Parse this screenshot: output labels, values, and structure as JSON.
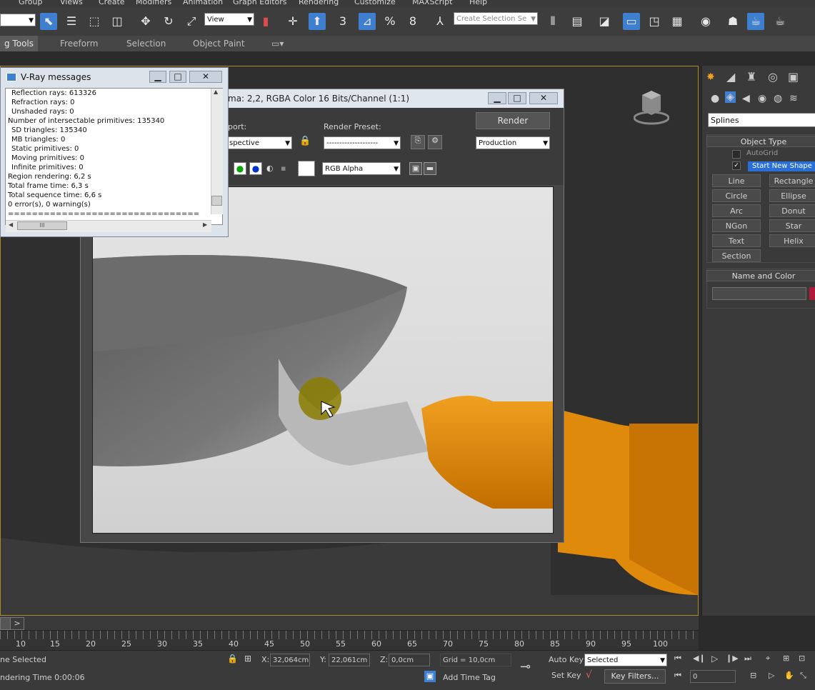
{
  "menu": [
    "Group",
    "Views",
    "Create",
    "Modifiers",
    "Animation",
    "Graph Editors",
    "Rendering",
    "Customize",
    "MAXScript",
    "Help"
  ],
  "toolbar": {
    "view_dropdown": "View",
    "selection_set_placeholder": "Create Selection Se",
    "snaps": {
      "snap3": "3",
      "percent": "%",
      "spinner": "8"
    }
  },
  "ribbon": {
    "tabs": [
      "g Tools",
      "Freeform",
      "Selection",
      "Object Paint"
    ]
  },
  "vray_messages": {
    "title": "V-Ray messages",
    "lines": [
      "Reflection rays: 613326",
      "Refraction rays: 0",
      "Unshaded rays: 0",
      "Number of intersectable primitives: 135340",
      "SD triangles: 135340",
      "MB triangles: 0",
      "Static primitives: 0",
      "Moving primitives: 0",
      "Infinite primitives: 0",
      "Region rendering: 6,2 s",
      "Total frame time: 6,3 s",
      "Total sequence time: 6,6 s",
      "0 error(s), 0 warning(s)",
      "================================"
    ],
    "scroll_label": "III"
  },
  "frame_buffer": {
    "title": "ma: 2,2, RGBA Color 16 Bits/Channel (1:1)",
    "viewport_label": "port:",
    "viewport_value": "spective",
    "render_preset_label": "Render Preset:",
    "render_preset_value": "--------------------",
    "render_button": "Render",
    "production_value": "Production",
    "channel_value": "RGB Alpha"
  },
  "command_panel": {
    "category": "Splines",
    "object_type_header": "Object Type",
    "autogrid": "AutoGrid",
    "start_new_shape": "Start New Shape",
    "buttons": [
      "Line",
      "Rectangle",
      "Circle",
      "Ellipse",
      "Arc",
      "Donut",
      "NGon",
      "Star",
      "Text",
      "Helix",
      "Section"
    ],
    "name_color_header": "Name and Color"
  },
  "timeline": {
    "ticks": [
      "10",
      "15",
      "20",
      "25",
      "30",
      "35",
      "40",
      "45",
      "50",
      "55",
      "60",
      "65",
      "70",
      "75",
      "80",
      "85",
      "90",
      "95",
      "100"
    ],
    "slider_label": ">"
  },
  "status": {
    "selection": "ne Selected",
    "rendering_time": "ndering Time  0:00:06",
    "x_label": "X:",
    "x_value": "32,064cm",
    "y_label": "Y:",
    "y_value": "22,061cm",
    "z_label": "Z:",
    "z_value": "0,0cm",
    "grid": "Grid = 10,0cm",
    "add_time_tag": "Add Time Tag",
    "auto_key": "Auto Key",
    "set_key": "Set Key",
    "selected_value": "Selected",
    "key_filters": "Key Filters...",
    "frame_value": "0"
  },
  "colors": {
    "accent": "#3f7fd0",
    "viewport_border": "#b08a2a",
    "handle_orange": "#e08a0c"
  }
}
